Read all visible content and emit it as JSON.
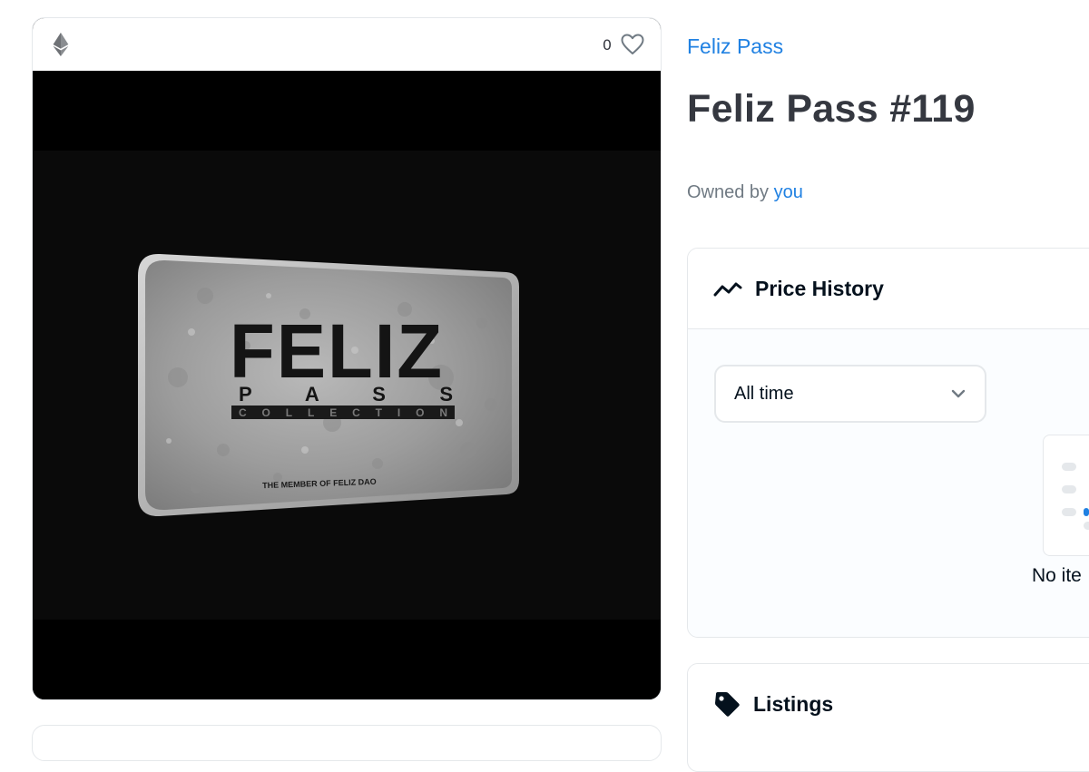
{
  "media": {
    "chain_icon": "ethereum-icon",
    "favorites_count": "0",
    "favorite_icon": "heart-outline-icon",
    "artwork": {
      "logo_text": "FELIZ",
      "subtitle": "P A S S",
      "band_text": "COLLECTION",
      "footer_text": "THE MEMBER OF FELIZ DAO"
    }
  },
  "item": {
    "collection_name": "Feliz Pass",
    "title": "Feliz Pass #119",
    "owned_by_label": "Owned by",
    "owner": "you"
  },
  "price_history": {
    "title": "Price History",
    "icon": "trend-line-icon",
    "time_filter": "All time",
    "empty_message": "No ite"
  },
  "listings": {
    "title": "Listings",
    "icon": "tag-icon"
  },
  "colors": {
    "link": "#2081e2",
    "text": "#353840",
    "border": "#e5e8eb"
  }
}
